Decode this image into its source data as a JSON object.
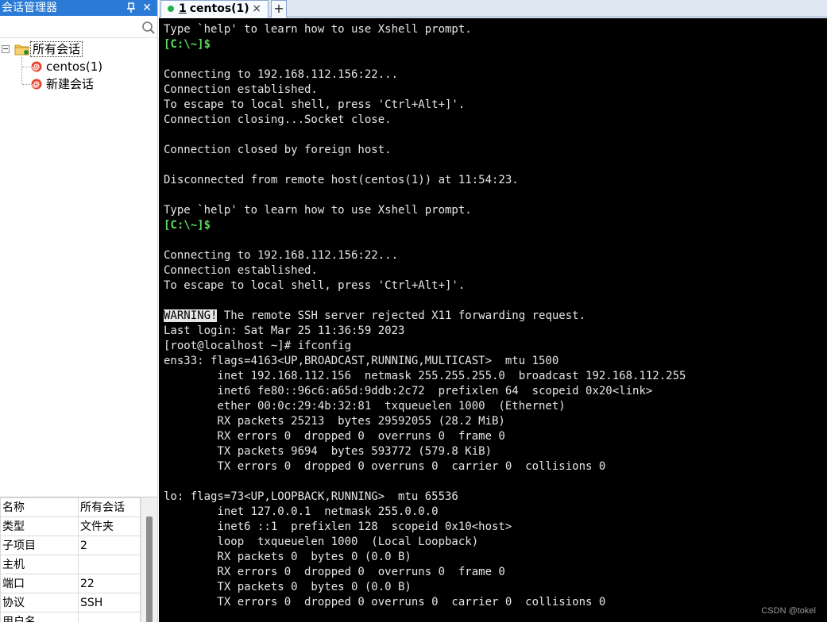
{
  "session_manager": {
    "title": "会话管理器",
    "search": {
      "placeholder": "",
      "value": ""
    },
    "tree": {
      "root_label": "所有会话",
      "children": [
        {
          "label": "centos(1)"
        },
        {
          "label": "新建会话"
        }
      ]
    },
    "properties": [
      {
        "key": "名称",
        "value": "所有会话"
      },
      {
        "key": "类型",
        "value": "文件夹"
      },
      {
        "key": "子项目",
        "value": "2"
      },
      {
        "key": "主机",
        "value": ""
      },
      {
        "key": "端口",
        "value": "22"
      },
      {
        "key": "协议",
        "value": "SSH"
      },
      {
        "key": "用户名",
        "value": ""
      }
    ]
  },
  "tabs": {
    "active": {
      "number": "1",
      "name": "centos(1)",
      "close": "×",
      "status_color": "#1fb24a"
    },
    "add_label": "+"
  },
  "terminal": {
    "lines": [
      {
        "text": "Type `help' to learn how to use Xshell prompt."
      },
      {
        "prompt": "[C:\\~]$",
        "text": ""
      },
      {
        "text": ""
      },
      {
        "text": "Connecting to 192.168.112.156:22..."
      },
      {
        "text": "Connection established."
      },
      {
        "text": "To escape to local shell, press 'Ctrl+Alt+]'."
      },
      {
        "text": "Connection closing...Socket close."
      },
      {
        "text": ""
      },
      {
        "text": "Connection closed by foreign host."
      },
      {
        "text": ""
      },
      {
        "text": "Disconnected from remote host(centos(1)) at 11:54:23."
      },
      {
        "text": ""
      },
      {
        "text": "Type `help' to learn how to use Xshell prompt."
      },
      {
        "prompt": "[C:\\~]$",
        "text": ""
      },
      {
        "text": ""
      },
      {
        "text": "Connecting to 192.168.112.156:22..."
      },
      {
        "text": "Connection established."
      },
      {
        "text": "To escape to local shell, press 'Ctrl+Alt+]'."
      },
      {
        "text": ""
      },
      {
        "highlight": "WARNING!",
        "text": " The remote SSH server rejected X11 forwarding request."
      },
      {
        "text": "Last login: Sat Mar 25 11:36:59 2023"
      },
      {
        "text": "[root@localhost ~]# ifconfig"
      },
      {
        "text": "ens33: flags=4163<UP,BROADCAST,RUNNING,MULTICAST>  mtu 1500"
      },
      {
        "text": "        inet 192.168.112.156  netmask 255.255.255.0  broadcast 192.168.112.255"
      },
      {
        "text": "        inet6 fe80::96c6:a65d:9ddb:2c72  prefixlen 64  scopeid 0x20<link>"
      },
      {
        "text": "        ether 00:0c:29:4b:32:81  txqueuelen 1000  (Ethernet)"
      },
      {
        "text": "        RX packets 25213  bytes 29592055 (28.2 MiB)"
      },
      {
        "text": "        RX errors 0  dropped 0  overruns 0  frame 0"
      },
      {
        "text": "        TX packets 9694  bytes 593772 (579.8 KiB)"
      },
      {
        "text": "        TX errors 0  dropped 0 overruns 0  carrier 0  collisions 0"
      },
      {
        "text": ""
      },
      {
        "text": "lo: flags=73<UP,LOOPBACK,RUNNING>  mtu 65536"
      },
      {
        "text": "        inet 127.0.0.1  netmask 255.0.0.0"
      },
      {
        "text": "        inet6 ::1  prefixlen 128  scopeid 0x10<host>"
      },
      {
        "text": "        loop  txqueuelen 1000  (Local Loopback)"
      },
      {
        "text": "        RX packets 0  bytes 0 (0.0 B)"
      },
      {
        "text": "        RX errors 0  dropped 0  overruns 0  frame 0"
      },
      {
        "text": "        TX packets 0  bytes 0 (0.0 B)"
      },
      {
        "text": "        TX errors 0  dropped 0 overruns 0  carrier 0  collisions 0"
      }
    ],
    "watermark": "CSDN @tokel"
  }
}
